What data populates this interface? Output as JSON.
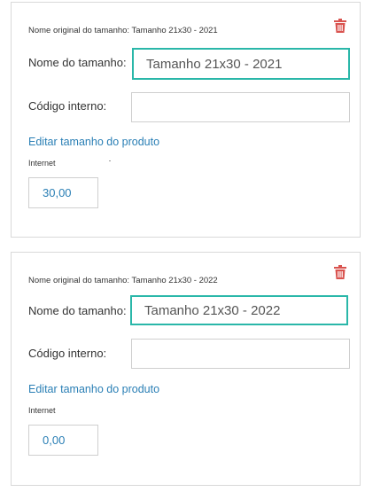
{
  "sizes": [
    {
      "original_name_text": "Nome original do tamanho: Tamanho 21x30 - 2021",
      "name_label": "Nome do tamanho:",
      "name_value": "Tamanho 21x30 - 2021",
      "code_label": "Código interno:",
      "code_value": "",
      "edit_link": "Editar tamanho do produto",
      "price_label": "Internet",
      "price_value": "30,00"
    },
    {
      "original_name_text": "Nome original do tamanho: Tamanho 21x30 - 2022",
      "name_label": "Nome do tamanho:",
      "name_value": "Tamanho 21x30 - 2022",
      "code_label": "Código interno:",
      "code_value": "",
      "edit_link": "Editar tamanho do produto",
      "price_label": "Internet",
      "price_value": "0,00"
    }
  ],
  "colors": {
    "accent_focus": "#2ab7a9",
    "link": "#2a7fb5",
    "delete_icon": "#d9534f"
  },
  "icons": {
    "delete": "trash-icon"
  }
}
